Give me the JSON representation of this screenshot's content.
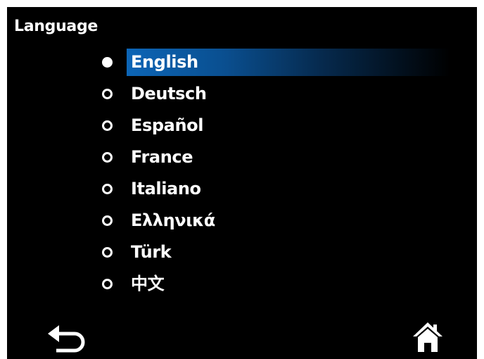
{
  "screen": {
    "title": "Language"
  },
  "languages": [
    {
      "label": "English",
      "selected": true
    },
    {
      "label": "Deutsch",
      "selected": false
    },
    {
      "label": "Español",
      "selected": false
    },
    {
      "label": "France",
      "selected": false
    },
    {
      "label": "Italiano",
      "selected": false
    },
    {
      "label": "Ελληνικά",
      "selected": false
    },
    {
      "label": "Türk",
      "selected": false
    },
    {
      "label": "中文",
      "selected": false
    }
  ],
  "footer": {
    "back_icon": "back-arrow-icon",
    "home_icon": "home-icon"
  },
  "colors": {
    "background": "#000000",
    "text": "#ffffff",
    "highlight": "#0c65b6"
  }
}
